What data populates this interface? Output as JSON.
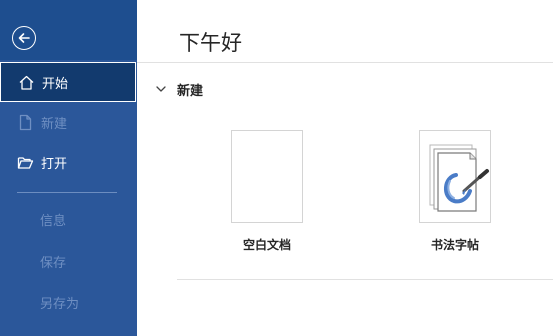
{
  "sidebar": {
    "items": [
      {
        "label": "开始",
        "icon": "home-icon",
        "state": "selected"
      },
      {
        "label": "新建",
        "icon": "new-document-icon",
        "state": "disabled"
      },
      {
        "label": "打开",
        "icon": "folder-open-icon",
        "state": "normal"
      },
      {
        "label": "信息",
        "state": "disabled"
      },
      {
        "label": "保存",
        "state": "disabled"
      },
      {
        "label": "另存为",
        "state": "disabled"
      }
    ],
    "colors": {
      "background": "#2b579a",
      "selected": "#123a6e",
      "disabled_text": "#6f8fc2"
    }
  },
  "main": {
    "greeting": "下午好",
    "section_title": "新建",
    "templates": [
      {
        "label": "空白文档",
        "thumbnail": "blank-document"
      },
      {
        "label": "书法字帖",
        "thumbnail": "calligraphy-brush-icon"
      }
    ]
  }
}
